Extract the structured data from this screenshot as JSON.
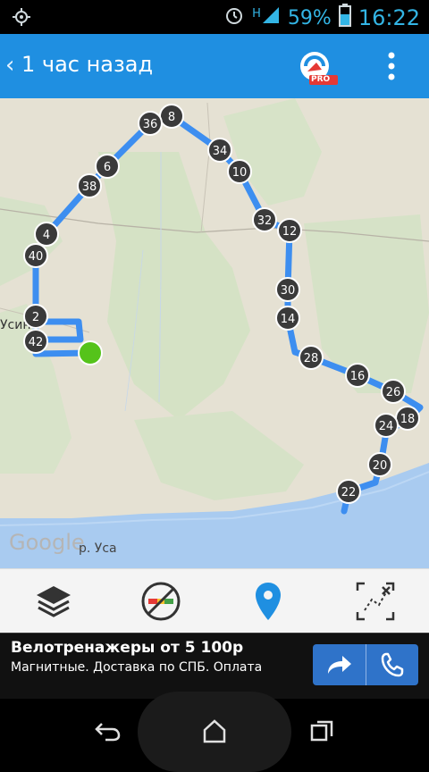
{
  "status": {
    "network": "H",
    "battery": "59%",
    "time": "16:22"
  },
  "appbar": {
    "title": "1 час назад",
    "logo_badge": "PRO"
  },
  "map": {
    "watermark": "Google",
    "river_label": "р. Уса",
    "town_label": "Усин",
    "markers": [
      "8",
      "36",
      "34",
      "6",
      "10",
      "38",
      "32",
      "4",
      "12",
      "40",
      "30",
      "2",
      "14",
      "42",
      "28",
      "16",
      "26",
      "18",
      "24",
      "20",
      "22"
    ]
  },
  "toolbar": {
    "items": [
      "layers-icon",
      "no-traffic-icon",
      "location-pin-icon",
      "route-measure-icon"
    ]
  },
  "ad": {
    "title": "Велотренажеры от 5 100р",
    "text": "Магнитные. Доставка по СПБ. Оплата",
    "accent": "#2f73c9"
  },
  "colors": {
    "appbar": "#1f8fe1",
    "route": "#3d8ef0",
    "start": "#55c31a"
  }
}
